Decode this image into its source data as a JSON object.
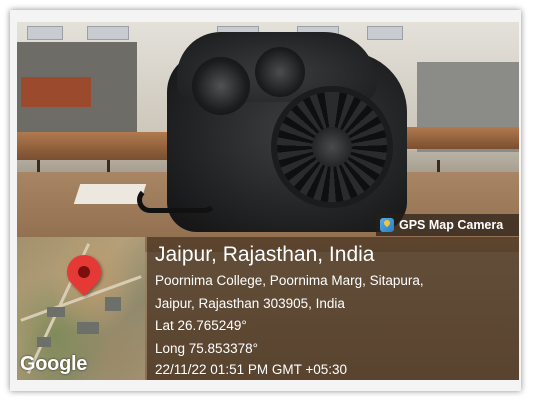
{
  "badge": {
    "icon": "gps-map-camera-icon",
    "label": "GPS Map Camera"
  },
  "location": {
    "title": "Jaipur, Rajasthan, India",
    "address_line_1": "Poornima College, Poornima Marg, Sitapura,",
    "address_line_2": "Jaipur, Rajasthan 303905, India",
    "latitude": "Lat 26.765249°",
    "longitude": "Long 75.853378°",
    "timestamp": "22/11/22 01:51 PM GMT +05:30"
  },
  "map": {
    "brand": "Google",
    "pin_icon": "map-pin-icon",
    "pin_color": "#e53935"
  }
}
